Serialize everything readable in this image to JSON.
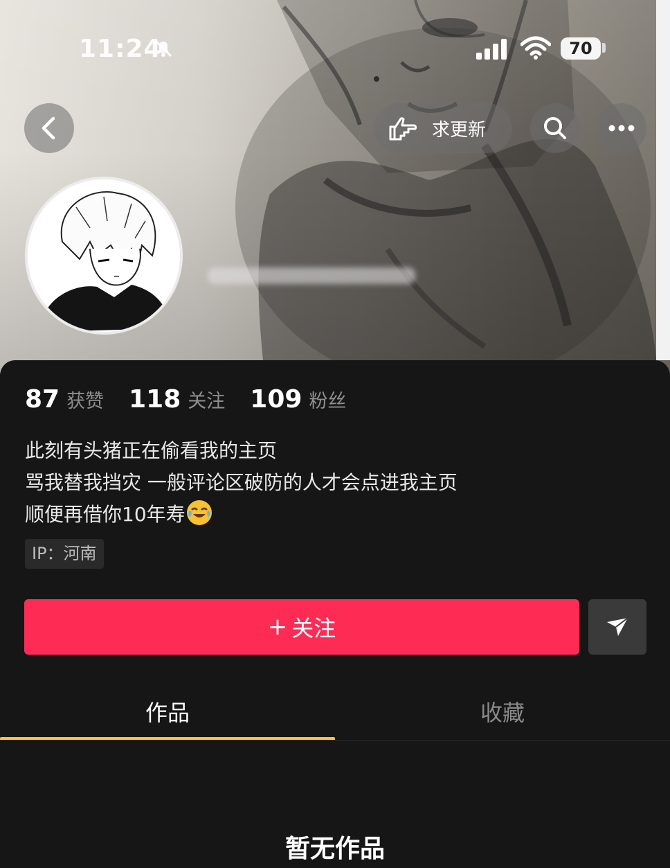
{
  "status_bar": {
    "time": "11:24",
    "battery": "70"
  },
  "header": {
    "update_label": "求更新"
  },
  "stats": [
    {
      "value": "87",
      "label": "获赞"
    },
    {
      "value": "118",
      "label": "关注"
    },
    {
      "value": "109",
      "label": "粉丝"
    }
  ],
  "bio": {
    "line1": "此刻有头猪正在偷看我的主页",
    "line2": "骂我替我挡灾 一般评论区破防的人才会点进我主页",
    "line3": "顺便再借你10年寿"
  },
  "ip": "IP：河南",
  "actions": {
    "follow_label": "关注"
  },
  "tabs": [
    {
      "label": "作品",
      "active": true
    },
    {
      "label": "收藏",
      "active": false
    }
  ],
  "empty_state": "暂无作品",
  "colors": {
    "accent": "#fe2c55",
    "tab_indicator": "#fdc531",
    "background": "#161616"
  }
}
